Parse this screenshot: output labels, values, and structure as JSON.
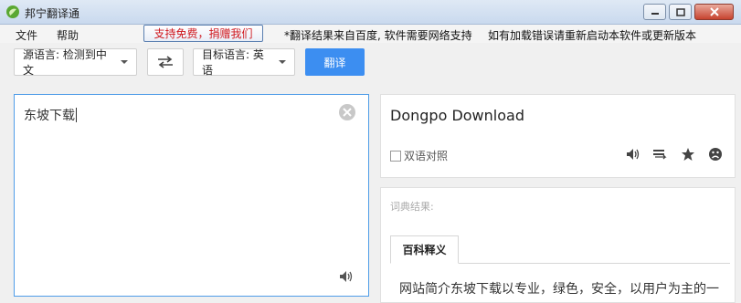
{
  "window": {
    "title": "邦宁翻译通"
  },
  "menu": {
    "file": "文件",
    "help": "帮助",
    "support_button": "支持免费，捐赠我们",
    "notice_1": "*翻译结果来自百度, 软件需要网络支持",
    "notice_2": "如有加载错误请重新启动本软件或更新版本"
  },
  "toolbar": {
    "source_lang": "源语言: 检测到中文",
    "target_lang": "目标语言: 英语",
    "translate_label": "翻译"
  },
  "input": {
    "text": "东坡下载"
  },
  "output": {
    "text": "Dongpo Download",
    "bilingual_label": "双语对照",
    "bilingual_checked": false
  },
  "dictionary": {
    "label": "词典结果:",
    "tabs": [
      {
        "label": "百科释义",
        "active": true
      }
    ],
    "content": "网站简介东坡下载以专业，绿色，安全，以用户为主的一"
  },
  "colors": {
    "accent": "#3c8ef1",
    "support_text": "#d0191f",
    "input_border": "#4f9de8"
  }
}
